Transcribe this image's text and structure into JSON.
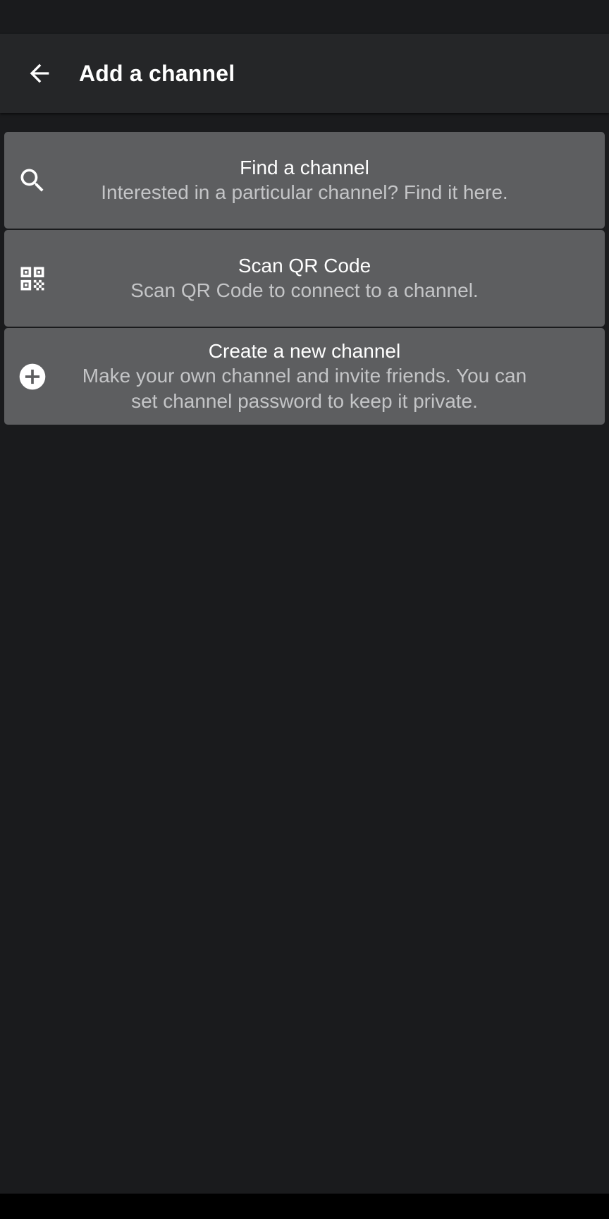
{
  "header": {
    "title": "Add a channel",
    "back_icon": "arrow-left-icon"
  },
  "options": [
    {
      "icon": "search-icon",
      "title": "Find a channel",
      "description": "Interested in a particular channel? Find it here."
    },
    {
      "icon": "qr-code-icon",
      "title": "Scan QR Code",
      "description": "Scan QR Code to connect to a channel."
    },
    {
      "icon": "add-circle-icon",
      "title": "Create a new channel",
      "description": "Make your own channel and invite friends. You can set channel password to keep it private."
    }
  ],
  "colors": {
    "background": "#1a1b1d",
    "app_bar": "#252628",
    "card": "#5d5e60",
    "title_text": "#ffffff",
    "description_text": "#c4c5c7"
  }
}
